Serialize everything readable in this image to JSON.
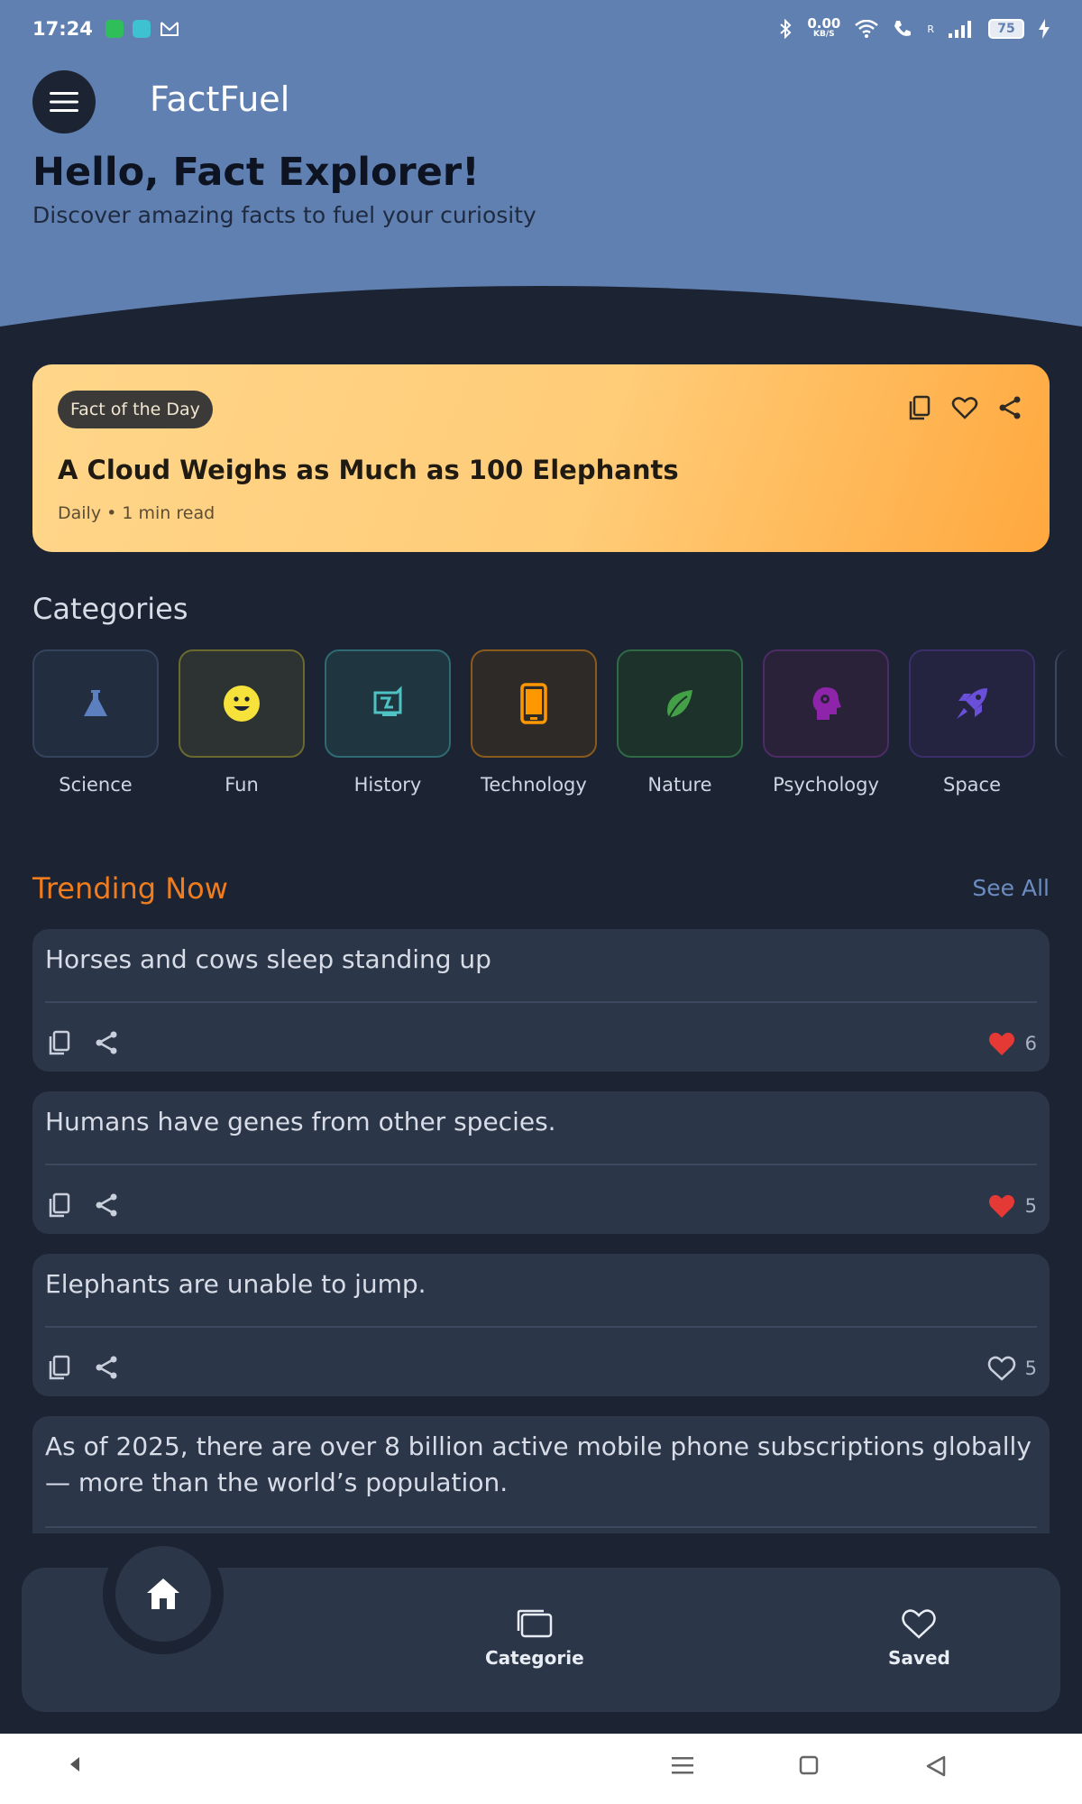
{
  "status": {
    "time": "17:24",
    "net_speed": "0.00",
    "net_unit": "KB/S",
    "roaming": "R",
    "battery": "75"
  },
  "header": {
    "app_title": "FactFuel",
    "greeting": "Hello, Fact Explorer!",
    "subtitle": "Discover amazing facts to fuel your curiosity"
  },
  "fact_of_day": {
    "badge": "Fact of the Day",
    "title": "A Cloud Weighs as Much as 100 Elephants",
    "meta": "Daily • 1 min read"
  },
  "categories": {
    "title": "Categories",
    "items": [
      {
        "label": "Science",
        "icon": "flask-icon",
        "color": "#5b7fbf"
      },
      {
        "label": "Fun",
        "icon": "smiley-icon",
        "color": "#f6e23b"
      },
      {
        "label": "History",
        "icon": "history-icon",
        "color": "#4fc3c3"
      },
      {
        "label": "Technology",
        "icon": "phone-icon",
        "color": "#ff9800"
      },
      {
        "label": "Nature",
        "icon": "leaf-icon",
        "color": "#43a047"
      },
      {
        "label": "Psychology",
        "icon": "head-icon",
        "color": "#8e24aa"
      },
      {
        "label": "Space",
        "icon": "rocket-icon",
        "color": "#6a4fd8"
      }
    ]
  },
  "trending": {
    "title": "Trending Now",
    "see_all": "See All",
    "items": [
      {
        "text": "Horses and cows sleep standing up",
        "likes": "6",
        "liked": true
      },
      {
        "text": "Humans have genes from other species.",
        "likes": "5",
        "liked": true
      },
      {
        "text": "Elephants are unable to jump.",
        "likes": "5",
        "liked": false
      },
      {
        "text": "As of 2025, there are over 8 billion active mobile phone subscriptions globally — more than the world’s population."
      }
    ]
  },
  "bottom_nav": {
    "categories_label": "Categorie",
    "saved_label": "Saved"
  },
  "colors": {
    "header_bg": "#6180b2",
    "page_bg": "#1c2433",
    "card_bg": "#2b3649",
    "accent_orange": "#f07c1e",
    "like_red": "#e53935"
  }
}
